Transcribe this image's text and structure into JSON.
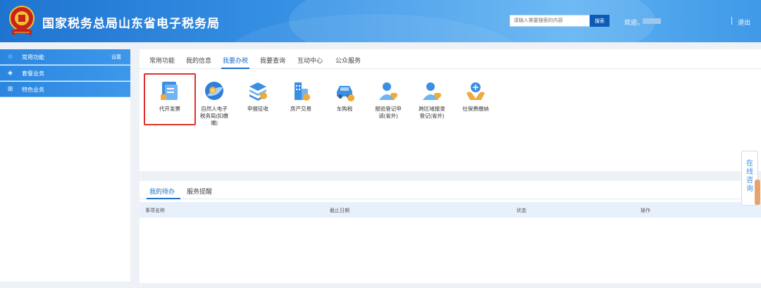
{
  "header": {
    "title": "国家税务总局山东省电子税务局",
    "search_placeholder": "请输入需要搜索的内容",
    "search_button": "搜索",
    "welcome": "欢迎，",
    "logout": "退出"
  },
  "sidebar": {
    "items": [
      {
        "label": "常用功能",
        "icon": "star-icon",
        "setting": "设置"
      },
      {
        "label": "套餐业务",
        "icon": "package-icon"
      },
      {
        "label": "特色业务",
        "icon": "grid-icon"
      }
    ]
  },
  "tabs": [
    "常用功能",
    "我的信息",
    "我要办税",
    "我要查询",
    "互动中心",
    "公众服务"
  ],
  "active_tab": "我要办税",
  "functions": [
    {
      "line1": "代开发票",
      "line2": "",
      "line3": "",
      "icon": "invoice-icon",
      "highlighted": true
    },
    {
      "line1": "自然人电子",
      "line2": "税务局(扣缴",
      "line3": "端)",
      "icon": "tax-bureau-icon"
    },
    {
      "line1": "申报征收",
      "line2": "",
      "line3": "",
      "icon": "declaration-icon"
    },
    {
      "line1": "房产交易",
      "line2": "",
      "line3": "",
      "icon": "real-estate-icon"
    },
    {
      "line1": "车购税",
      "line2": "",
      "line3": "",
      "icon": "car-tax-icon"
    },
    {
      "line1": "报验登记申",
      "line2": "请(省外)",
      "line3": "",
      "icon": "registration-icon"
    },
    {
      "line1": "跨区域报录",
      "line2": "登记(省外)",
      "line3": "",
      "icon": "cross-region-icon"
    },
    {
      "line1": "社保费缴纳",
      "line2": "",
      "line3": "",
      "icon": "social-security-icon"
    }
  ],
  "bottom_tabs": [
    "我的待办",
    "服务提醒"
  ],
  "table_headers": [
    "事项名称",
    "截止日期",
    "状态",
    "操作"
  ],
  "consult": {
    "chars": [
      "在",
      "线",
      "咨",
      "询"
    ]
  },
  "colors": {
    "header_blue": "#2b86e0",
    "accent": "#1d6fc9",
    "highlight": "#e0302a"
  }
}
